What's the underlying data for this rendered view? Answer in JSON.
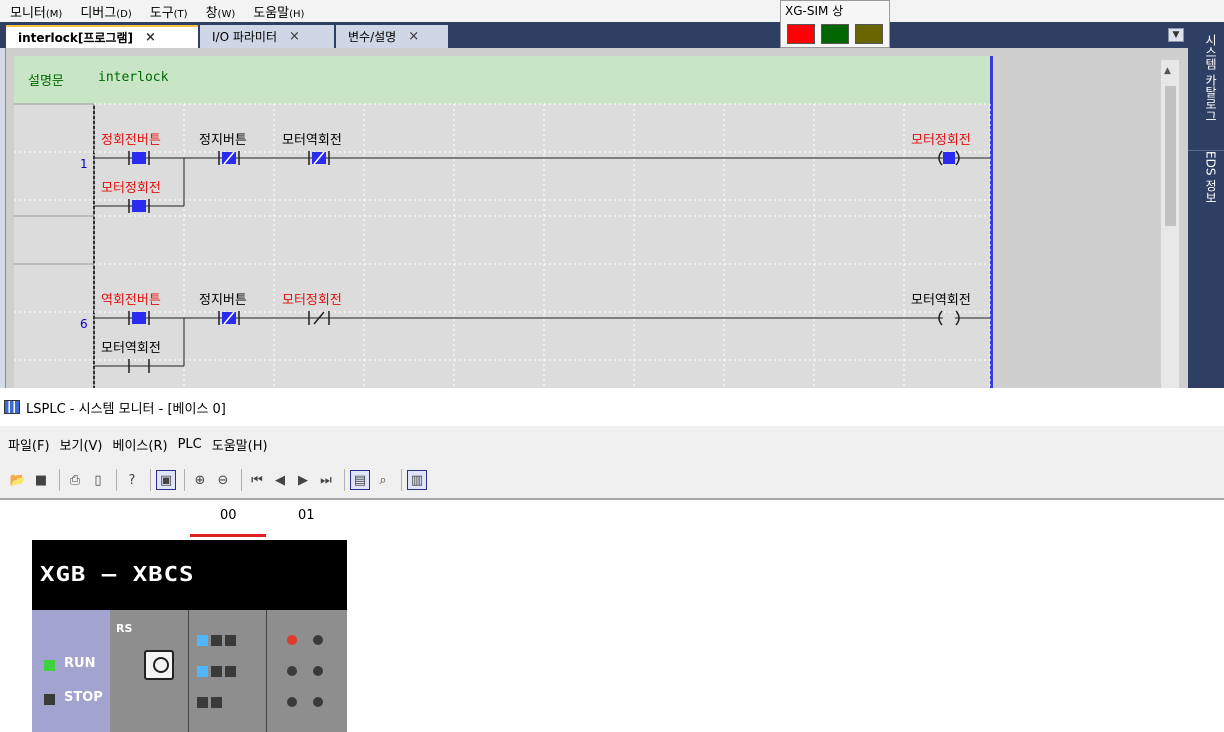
{
  "menubar": {
    "items": [
      {
        "label": "모니터",
        "key": "(M)"
      },
      {
        "label": "디버그",
        "key": "(D)"
      },
      {
        "label": "도구",
        "key": "(T)"
      },
      {
        "label": "창",
        "key": "(W)"
      },
      {
        "label": "도움말",
        "key": "(H)"
      }
    ]
  },
  "status_popup": {
    "title": "XG-SIM 상",
    "colors": [
      "#ff0000",
      "#006600",
      "#6b6500"
    ]
  },
  "tabs": [
    {
      "label": "interlock[프로그램]",
      "active": true
    },
    {
      "label": "I/O 파라미터",
      "active": false
    },
    {
      "label": "변수/설명",
      "active": false
    }
  ],
  "tab_close_glyph": "×",
  "editor": {
    "comment_label": "설명문",
    "comment_text": "interlock",
    "rungs": [
      {
        "number": "1",
        "contacts": [
          {
            "label": "정회전버튼",
            "type": "NO",
            "active": true,
            "label_color": "red"
          },
          {
            "label": "정지버튼",
            "type": "NC",
            "active": true,
            "label_color": "black"
          },
          {
            "label": "모터역회전",
            "type": "NC",
            "active": true,
            "label_color": "black"
          }
        ],
        "branch": {
          "label": "모터정회전",
          "type": "NO",
          "active": true,
          "label_color": "red"
        },
        "coil": {
          "label": "모터정회전",
          "active": true,
          "label_color": "red"
        }
      },
      {
        "number": "6",
        "contacts": [
          {
            "label": "역회전버튼",
            "type": "NO",
            "active": true,
            "label_color": "red"
          },
          {
            "label": "정지버튼",
            "type": "NC",
            "active": true,
            "label_color": "black"
          },
          {
            "label": "모터정회전",
            "type": "NC",
            "active": false,
            "label_color": "red"
          }
        ],
        "branch": {
          "label": "모터역회전",
          "type": "NO",
          "active": false,
          "label_color": "black"
        },
        "coil": {
          "label": "모터역회전",
          "active": false,
          "label_color": "black"
        }
      }
    ]
  },
  "side_panel": {
    "tabs": [
      "시스템 카탈로그",
      "EDS 정보"
    ]
  },
  "monitor": {
    "window_title": "LSPLC - 시스템 모니터 - [베이스 0]",
    "menu": [
      {
        "label": "파일",
        "key": "(F)"
      },
      {
        "label": "보기",
        "key": "(V)"
      },
      {
        "label": "베이스",
        "key": "(R)"
      },
      {
        "label": "PLC",
        "key": ""
      },
      {
        "label": "도움말",
        "key": "(H)"
      }
    ],
    "toolbar_icons": [
      "open-icon",
      "save-icon",
      "print-icon",
      "print-preview-icon",
      "help-icon",
      "monitor-icon",
      "zoom-in-icon",
      "zoom-out-icon",
      "first-icon",
      "prev-icon",
      "next-icon",
      "last-icon",
      "io-icon",
      "io-info-icon",
      "module-icon"
    ],
    "slots": [
      "00",
      "01"
    ],
    "plc": {
      "model": "XGB — XBCS",
      "run_label": "RUN",
      "stop_label": "STOP",
      "rs_label": "RS",
      "run_led": "#3fd13f",
      "stop_led": "#3a3a3a",
      "slot0_leds": [
        "#4fb7ff",
        "#4fb7ff",
        "#3a3a3a"
      ],
      "slot1_red_led": "#e03a2a"
    }
  }
}
